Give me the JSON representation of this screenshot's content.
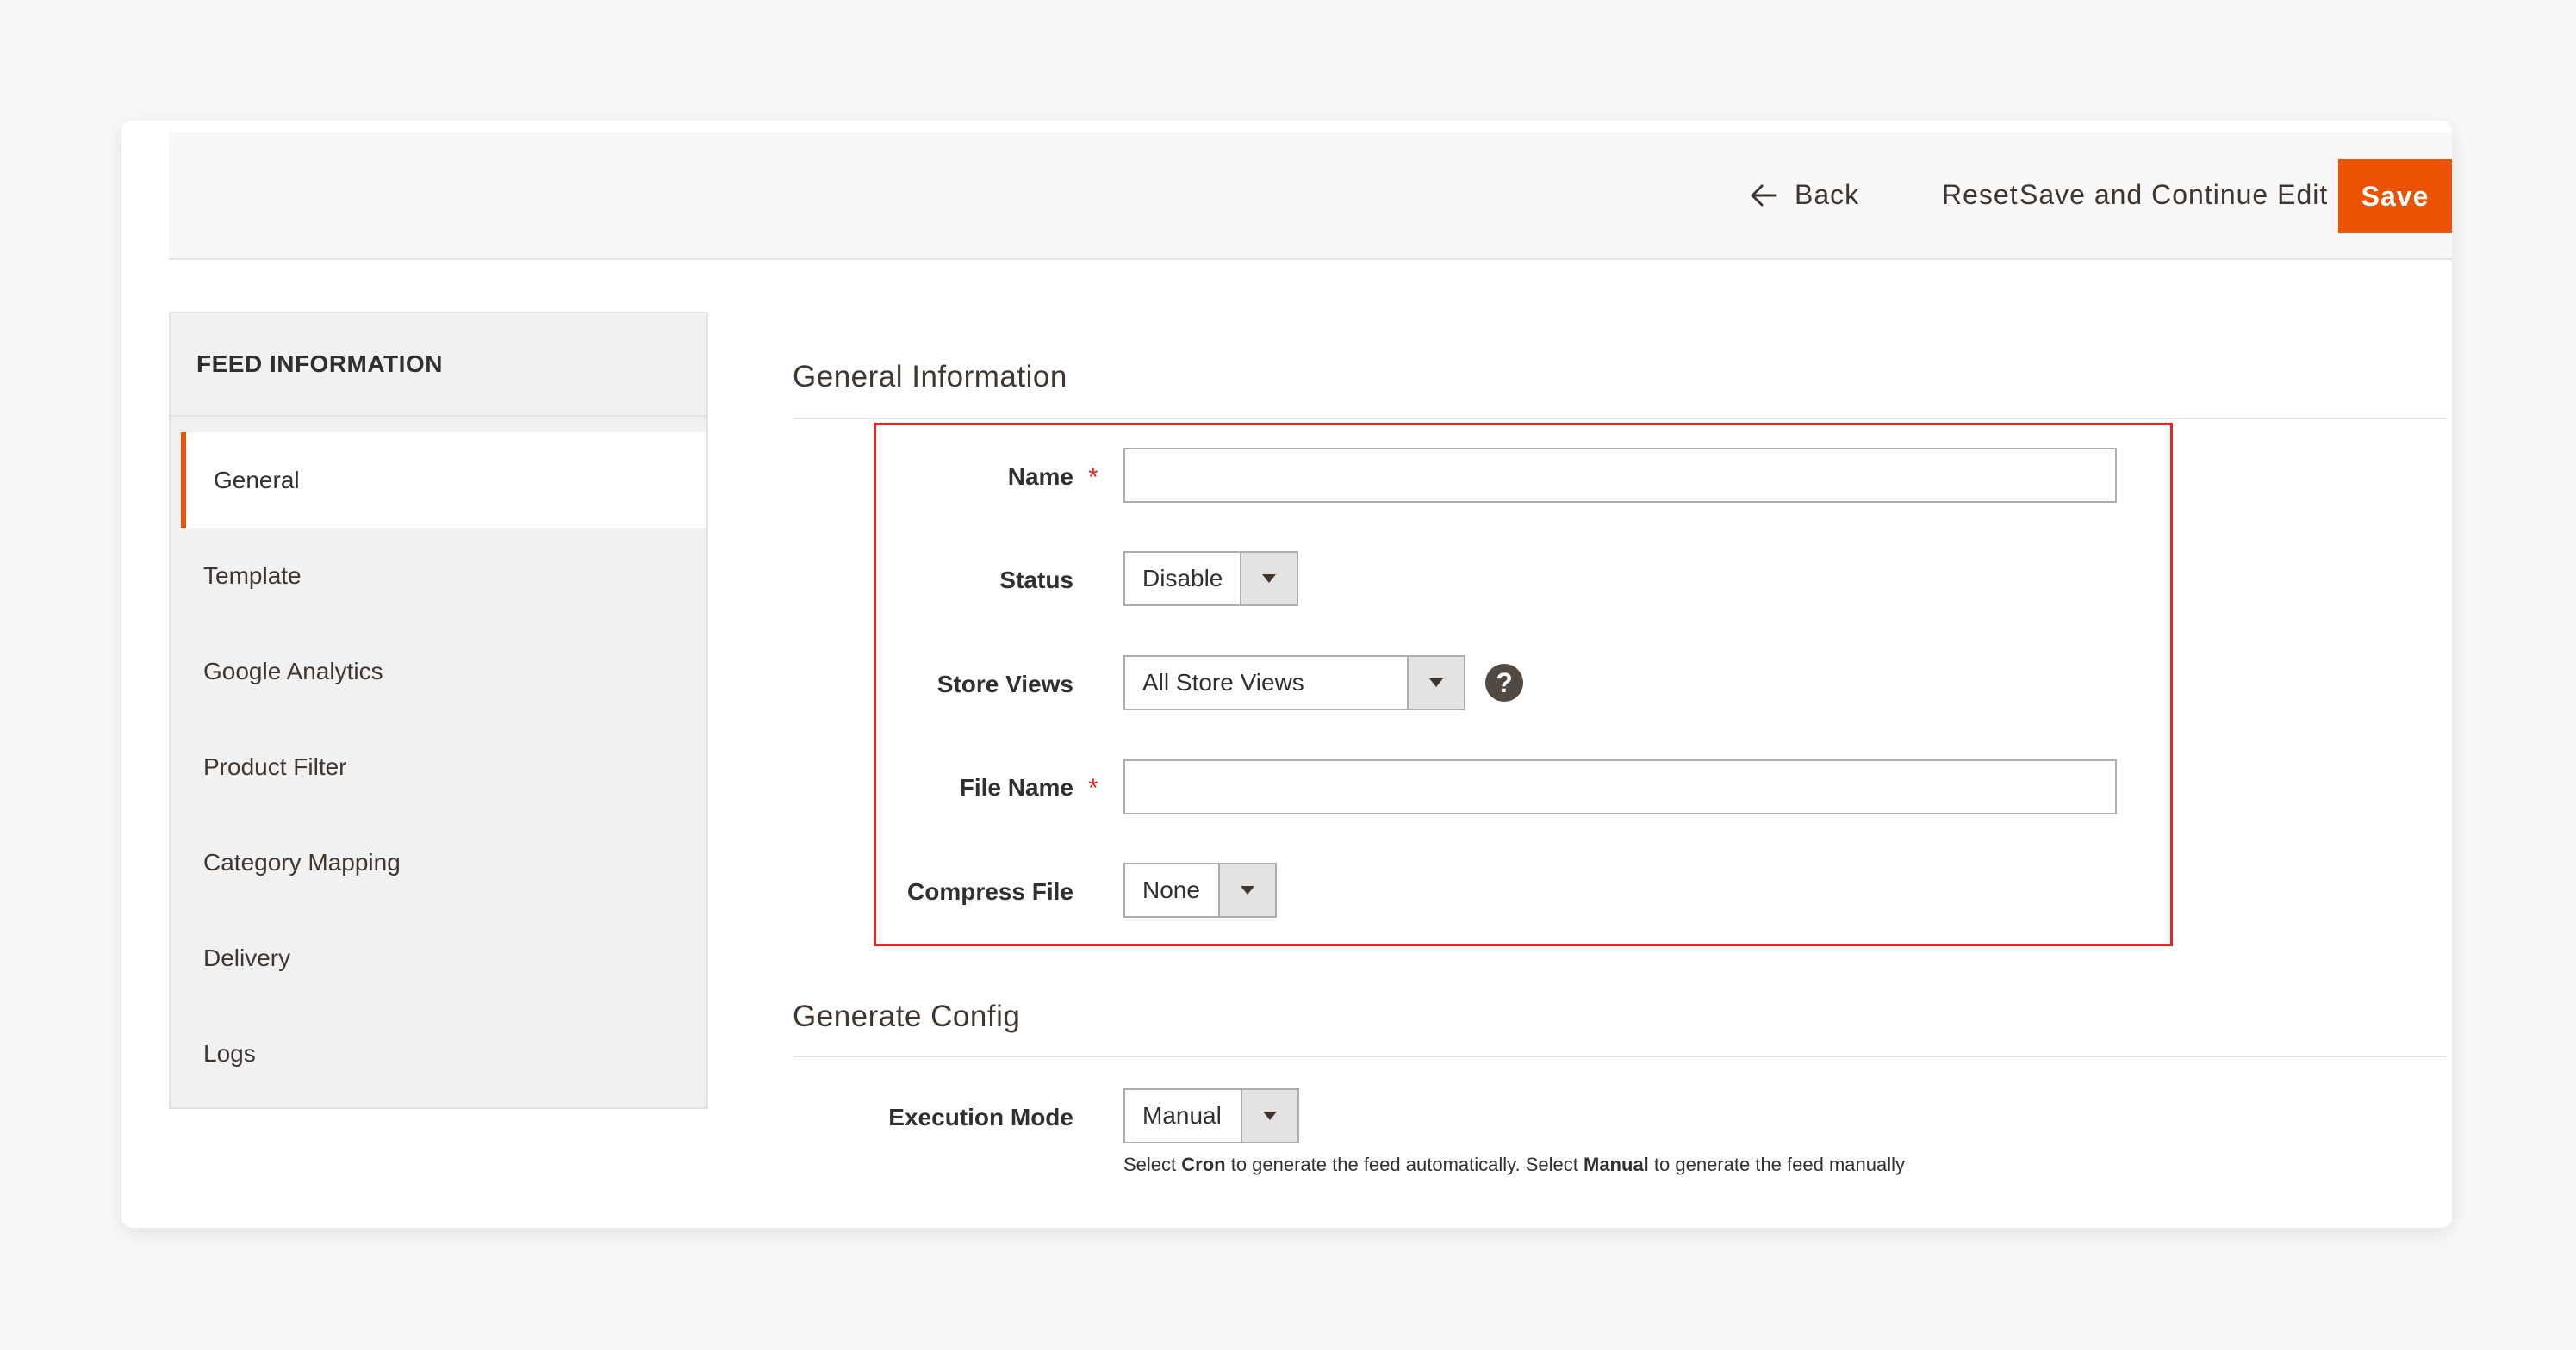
{
  "toolbar": {
    "back_label": "Back",
    "reset_label": "Reset",
    "save_continue_label": "Save and Continue Edit",
    "save_label": "Save"
  },
  "sidebar": {
    "title": "FEED INFORMATION",
    "items": [
      {
        "label": "General",
        "active": true
      },
      {
        "label": "Template"
      },
      {
        "label": "Google Analytics"
      },
      {
        "label": "Product Filter"
      },
      {
        "label": "Category Mapping"
      },
      {
        "label": "Delivery"
      },
      {
        "label": "Logs"
      }
    ]
  },
  "general": {
    "title": "General Information",
    "name_label": "Name",
    "name_value": "",
    "status_label": "Status",
    "status_value": "Disable",
    "store_views_label": "Store Views",
    "store_views_value": "All Store Views",
    "help_icon": "?",
    "file_name_label": "File Name",
    "file_name_value": "",
    "compress_label": "Compress File",
    "compress_value": "None",
    "required_mark": "*"
  },
  "generate": {
    "title": "Generate Config",
    "execution_label": "Execution Mode",
    "execution_value": "Manual",
    "note_part1": "Select ",
    "note_cron": "Cron",
    "note_part2": " to generate the feed automatically. Select ",
    "note_manual": "Manual",
    "note_part3": " to generate the feed manually"
  },
  "colors": {
    "accent": "#eb5202",
    "highlight": "#e22626"
  },
  "icons": {
    "back": "arrow-left-icon",
    "dropdown": "triangle-down-icon",
    "help": "question-circle-icon"
  }
}
